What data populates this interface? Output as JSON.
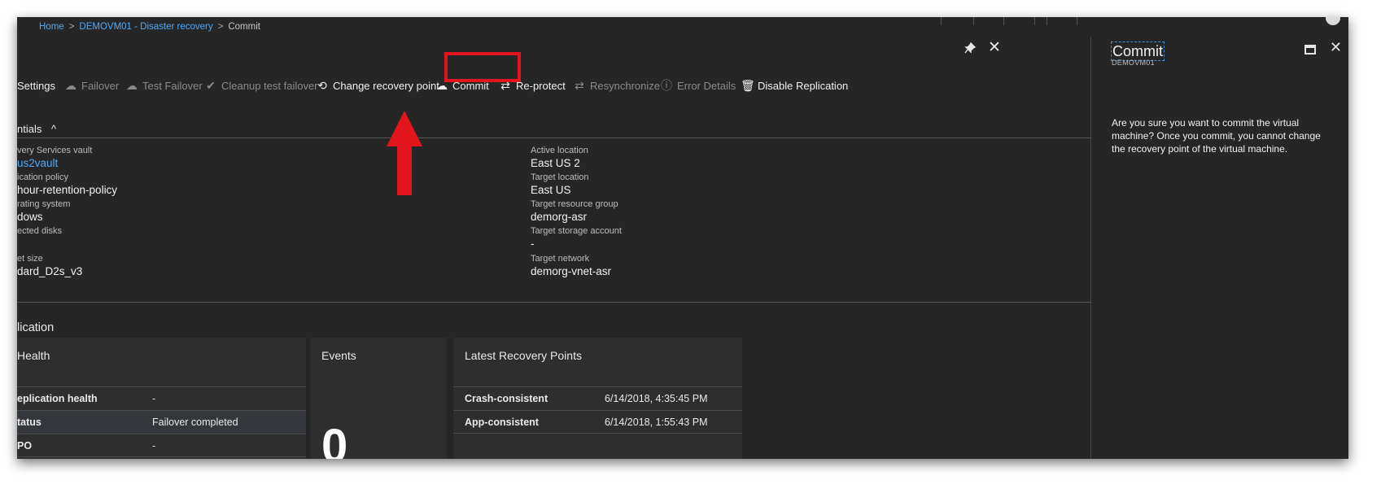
{
  "breadcrumb": {
    "home": "Home",
    "vm": "DEMOVM01 - Disaster recovery",
    "current": "Commit",
    "separator": ">"
  },
  "main": {
    "pin_icon": "pin-icon",
    "close_icon": "close-icon",
    "commands": {
      "settings": "Settings",
      "failover": "Failover",
      "test_failover": "Test Failover",
      "cleanup": "Cleanup test failover",
      "change_recovery": "Change recovery point",
      "commit": "Commit",
      "reprotect": "Re-protect",
      "resync": "Resynchronize",
      "error_details": "Error Details",
      "disable_replication": "Disable Replication"
    },
    "essentials_label": "ntials",
    "essentials_toggle": "^",
    "fields": {
      "vault_label": "very Services vault",
      "vault_value": "us2vault",
      "policy_label": "ication policy",
      "policy_value": "hour-retention-policy",
      "os_label": "rating system",
      "os_value": "dows",
      "disks_label": "ected disks",
      "size_label": "et size",
      "size_value": "dard_D2s_v3",
      "active_loc_label": "Active location",
      "active_loc_value": "East US 2",
      "target_loc_label": "Target location",
      "target_loc_value": "East US",
      "target_rg_label": "Target resource group",
      "target_rg_value": "demorg-asr",
      "target_sa_label": "Target storage account",
      "target_sa_value": "-",
      "target_net_label": "Target network",
      "target_net_value": "demorg-vnet-asr"
    },
    "replication_label": "lication",
    "health_card": {
      "title": "Health",
      "rows": [
        {
          "key": "eplication health",
          "value": "-"
        },
        {
          "key": "tatus",
          "value": "Failover completed"
        },
        {
          "key": "PO",
          "value": "-"
        }
      ]
    },
    "events_card": {
      "title": "Events",
      "count": "0"
    },
    "recovery_card": {
      "title": "Latest Recovery Points",
      "rows": [
        {
          "key": "Crash-consistent",
          "value": "6/14/2018, 4:35:45 PM"
        },
        {
          "key": "App-consistent",
          "value": "6/14/2018, 1:55:43 PM"
        }
      ]
    }
  },
  "side": {
    "title": "Commit",
    "subtitle": "DEMOVM01",
    "message": "Are you sure you want to commit the virtual machine? Once you commit, you cannot change the recovery point of the virtual machine."
  },
  "colors": {
    "background": "#262626",
    "link": "#4ea8f5",
    "highlight": "#e3141b"
  }
}
